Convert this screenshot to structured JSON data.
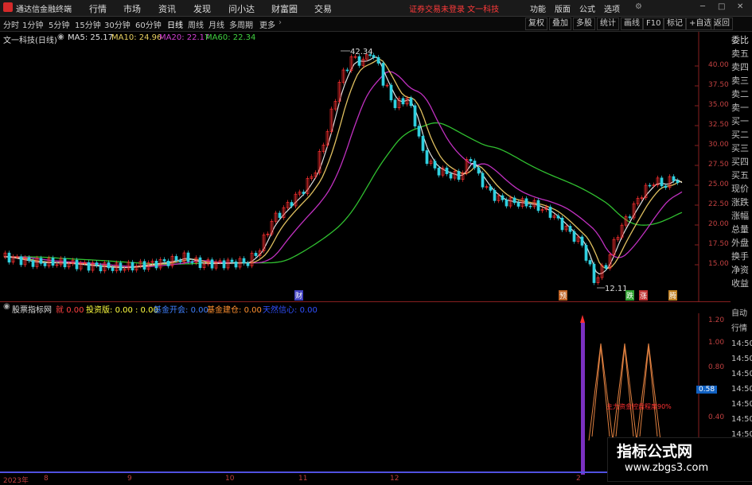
{
  "titlebar": {
    "app_name": "通达信金融终端",
    "menus": [
      "行情",
      "市场",
      "资讯",
      "发现",
      "问小达",
      "财富圈",
      "交易"
    ],
    "warning": "证券交易未登录  文一科技",
    "right_items": [
      "功能",
      "版面",
      "公式",
      "选项"
    ]
  },
  "toolbar": {
    "timeframes": [
      "分时",
      "1分钟",
      "5分钟",
      "15分钟",
      "30分钟",
      "60分钟",
      "日线",
      "周线",
      "月线",
      "多周期",
      "更多"
    ],
    "active_timeframe": "日线",
    "buttons": [
      "复权",
      "叠加",
      "多股",
      "统计",
      "画线",
      "F10",
      "标记",
      "+自选",
      "返回"
    ]
  },
  "info": {
    "stock": "文一科技(日线)",
    "ma5_label": "MA5: 25.17",
    "ma10_label": "MA10: 24.96",
    "ma20_label": "MA20: 22.17",
    "ma60_label": "MA60: 22.34"
  },
  "price_axis": [
    "40.00",
    "37.50",
    "35.00",
    "32.50",
    "30.00",
    "27.50",
    "25.00",
    "22.50",
    "20.00",
    "17.50",
    "15.00"
  ],
  "annotations": {
    "high": "42.34",
    "low": "12.11"
  },
  "event_badges": [
    "财",
    "预",
    "跌",
    "涨",
    "腾"
  ],
  "right_panel": [
    "委比",
    "卖五",
    "卖四",
    "卖三",
    "卖二",
    "卖一",
    "买一",
    "买二",
    "买三",
    "买四",
    "买五",
    "现价",
    "涨跌",
    "涨幅",
    "总量",
    "外盘",
    "换手",
    "净资",
    "收益"
  ],
  "indicator": {
    "name": "股票指标网",
    "items": [
      {
        "label": "就",
        "value": "0.00",
        "color": "#ff4040"
      },
      {
        "label": "投资版:",
        "value": "0.00 : 0.00",
        "color": "#ffff40"
      },
      {
        "label": "基金开会:",
        "value": "0.00",
        "color": "#4080ff"
      },
      {
        "label": "基金建仓:",
        "value": "0.00",
        "color": "#ff9030"
      },
      {
        "label": "天然信心:",
        "value": "0.00",
        "color": "#3050ff"
      }
    ],
    "axis": [
      "1.20",
      "1.00",
      "0.80",
      "0.58",
      "0.40",
      "0.20"
    ],
    "current": "0.58",
    "right_labels": [
      "自动",
      "行情",
      "14:50",
      "14:50",
      "14:50",
      "14:50",
      "14:50",
      "14:50",
      "14:50",
      "14:50",
      "14:50"
    ],
    "note": "主力资金控盘程度90%"
  },
  "x_axis": [
    "2023年",
    "8",
    "9",
    "10",
    "11",
    "12",
    "2"
  ],
  "watermark": {
    "title": "指标公式网",
    "url": "www.zbgs3.com"
  }
}
